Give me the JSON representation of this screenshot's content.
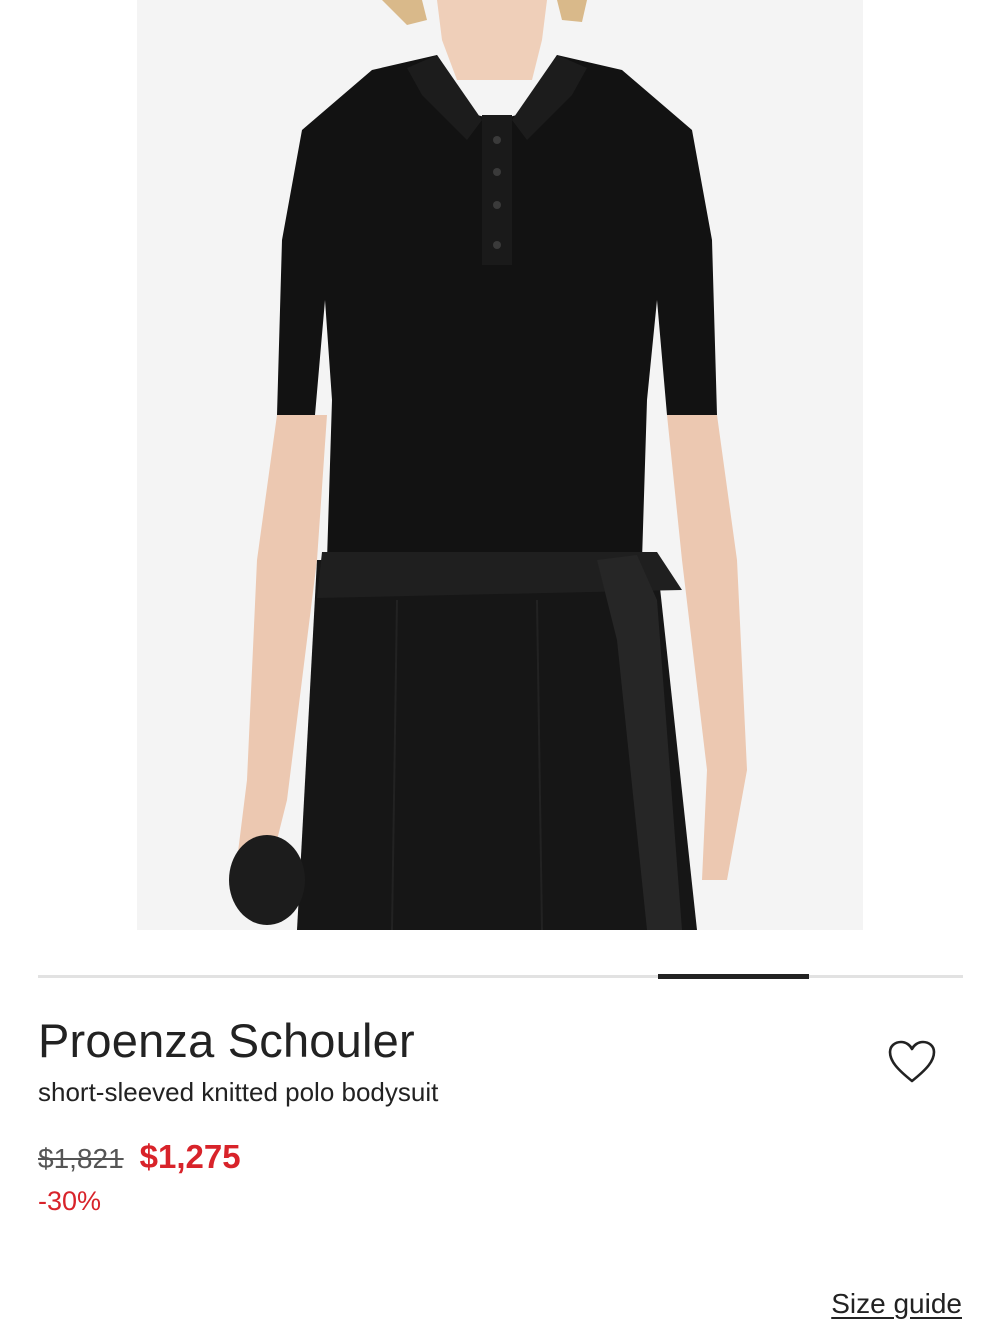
{
  "product": {
    "brand": "Proenza Schouler",
    "name": "short-sleeved knitted polo bodysuit",
    "price_original": "$1,821",
    "price_sale": "$1,275",
    "discount": "-30%"
  },
  "carousel": {
    "progress_start_fraction": 0.67,
    "progress_end_fraction": 0.833
  },
  "links": {
    "size_guide": "Size guide"
  },
  "icons": {
    "wishlist": "heart-outline-icon"
  },
  "colors": {
    "sale": "#d8232a",
    "text": "#222222",
    "track": "#e2e2e2",
    "image_bg": "#f3f3f3"
  }
}
